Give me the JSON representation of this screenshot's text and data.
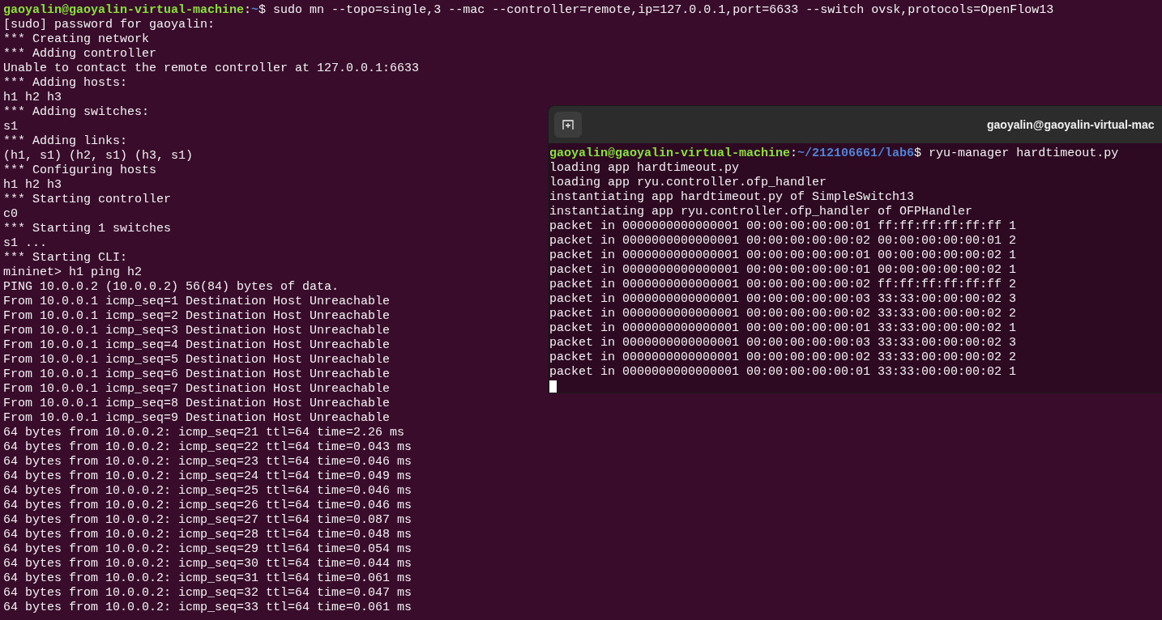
{
  "main_terminal": {
    "lines": [
      {
        "kind": "prompt",
        "user": "gaoyalin@gaoyalin-virtual-machine",
        "separator": ":",
        "path": "~",
        "command": "$ sudo mn --topo=single,3 --mac --controller=remote,ip=127.0.0.1,port=6633 --switch ovsk,protocols=OpenFlow13"
      },
      {
        "kind": "output",
        "text": "[sudo] password for gaoyalin:"
      },
      {
        "kind": "output",
        "text": "*** Creating network"
      },
      {
        "kind": "output",
        "text": "*** Adding controller"
      },
      {
        "kind": "output",
        "text": "Unable to contact the remote controller at 127.0.0.1:6633"
      },
      {
        "kind": "output",
        "text": "*** Adding hosts:"
      },
      {
        "kind": "output",
        "text": "h1 h2 h3"
      },
      {
        "kind": "output",
        "text": "*** Adding switches:"
      },
      {
        "kind": "output",
        "text": "s1"
      },
      {
        "kind": "output",
        "text": "*** Adding links:"
      },
      {
        "kind": "output",
        "text": "(h1, s1) (h2, s1) (h3, s1)"
      },
      {
        "kind": "output",
        "text": "*** Configuring hosts"
      },
      {
        "kind": "output",
        "text": "h1 h2 h3"
      },
      {
        "kind": "output",
        "text": "*** Starting controller"
      },
      {
        "kind": "output",
        "text": "c0"
      },
      {
        "kind": "output",
        "text": "*** Starting 1 switches"
      },
      {
        "kind": "output",
        "text": "s1 ..."
      },
      {
        "kind": "output",
        "text": "*** Starting CLI:"
      },
      {
        "kind": "output",
        "text": "mininet> h1 ping h2"
      },
      {
        "kind": "output",
        "text": "PING 10.0.0.2 (10.0.0.2) 56(84) bytes of data."
      },
      {
        "kind": "output",
        "text": "From 10.0.0.1 icmp_seq=1 Destination Host Unreachable"
      },
      {
        "kind": "output",
        "text": "From 10.0.0.1 icmp_seq=2 Destination Host Unreachable"
      },
      {
        "kind": "output",
        "text": "From 10.0.0.1 icmp_seq=3 Destination Host Unreachable"
      },
      {
        "kind": "output",
        "text": "From 10.0.0.1 icmp_seq=4 Destination Host Unreachable"
      },
      {
        "kind": "output",
        "text": "From 10.0.0.1 icmp_seq=5 Destination Host Unreachable"
      },
      {
        "kind": "output",
        "text": "From 10.0.0.1 icmp_seq=6 Destination Host Unreachable"
      },
      {
        "kind": "output",
        "text": "From 10.0.0.1 icmp_seq=7 Destination Host Unreachable"
      },
      {
        "kind": "output",
        "text": "From 10.0.0.1 icmp_seq=8 Destination Host Unreachable"
      },
      {
        "kind": "output",
        "text": "From 10.0.0.1 icmp_seq=9 Destination Host Unreachable"
      },
      {
        "kind": "output",
        "text": "64 bytes from 10.0.0.2: icmp_seq=21 ttl=64 time=2.26 ms"
      },
      {
        "kind": "output",
        "text": "64 bytes from 10.0.0.2: icmp_seq=22 ttl=64 time=0.043 ms"
      },
      {
        "kind": "output",
        "text": "64 bytes from 10.0.0.2: icmp_seq=23 ttl=64 time=0.046 ms"
      },
      {
        "kind": "output",
        "text": "64 bytes from 10.0.0.2: icmp_seq=24 ttl=64 time=0.049 ms"
      },
      {
        "kind": "output",
        "text": "64 bytes from 10.0.0.2: icmp_seq=25 ttl=64 time=0.046 ms"
      },
      {
        "kind": "output",
        "text": "64 bytes from 10.0.0.2: icmp_seq=26 ttl=64 time=0.046 ms"
      },
      {
        "kind": "output",
        "text": "64 bytes from 10.0.0.2: icmp_seq=27 ttl=64 time=0.087 ms"
      },
      {
        "kind": "output",
        "text": "64 bytes from 10.0.0.2: icmp_seq=28 ttl=64 time=0.048 ms"
      },
      {
        "kind": "output",
        "text": "64 bytes from 10.0.0.2: icmp_seq=29 ttl=64 time=0.054 ms"
      },
      {
        "kind": "output",
        "text": "64 bytes from 10.0.0.2: icmp_seq=30 ttl=64 time=0.044 ms"
      },
      {
        "kind": "output",
        "text": "64 bytes from 10.0.0.2: icmp_seq=31 ttl=64 time=0.061 ms"
      },
      {
        "kind": "output",
        "text": "64 bytes from 10.0.0.2: icmp_seq=32 ttl=64 time=0.047 ms"
      },
      {
        "kind": "output",
        "text": "64 bytes from 10.0.0.2: icmp_seq=33 ttl=64 time=0.061 ms"
      }
    ]
  },
  "ryu_window": {
    "title": "gaoyalin@gaoyalin-virtual-mac",
    "lines": [
      {
        "kind": "prompt",
        "user": "gaoyalin@gaoyalin-virtual-machine",
        "separator": ":",
        "path": "~/212106661/lab6",
        "command": "$ ryu-manager hardtimeout.py"
      },
      {
        "kind": "output",
        "text": "loading app hardtimeout.py"
      },
      {
        "kind": "output",
        "text": "loading app ryu.controller.ofp_handler"
      },
      {
        "kind": "output",
        "text": "instantiating app hardtimeout.py of SimpleSwitch13"
      },
      {
        "kind": "output",
        "text": "instantiating app ryu.controller.ofp_handler of OFPHandler"
      },
      {
        "kind": "output",
        "text": "packet in 0000000000000001 00:00:00:00:00:01 ff:ff:ff:ff:ff:ff 1"
      },
      {
        "kind": "output",
        "text": "packet in 0000000000000001 00:00:00:00:00:02 00:00:00:00:00:01 2"
      },
      {
        "kind": "output",
        "text": "packet in 0000000000000001 00:00:00:00:00:01 00:00:00:00:00:02 1"
      },
      {
        "kind": "output",
        "text": "packet in 0000000000000001 00:00:00:00:00:01 00:00:00:00:00:02 1"
      },
      {
        "kind": "output",
        "text": "packet in 0000000000000001 00:00:00:00:00:02 ff:ff:ff:ff:ff:ff 2"
      },
      {
        "kind": "output",
        "text": "packet in 0000000000000001 00:00:00:00:00:03 33:33:00:00:00:02 3"
      },
      {
        "kind": "output",
        "text": "packet in 0000000000000001 00:00:00:00:00:02 33:33:00:00:00:02 2"
      },
      {
        "kind": "output",
        "text": "packet in 0000000000000001 00:00:00:00:00:01 33:33:00:00:00:02 1"
      },
      {
        "kind": "output",
        "text": "packet in 0000000000000001 00:00:00:00:00:03 33:33:00:00:00:02 3"
      },
      {
        "kind": "output",
        "text": "packet in 0000000000000001 00:00:00:00:00:02 33:33:00:00:00:02 2"
      },
      {
        "kind": "output",
        "text": "packet in 0000000000000001 00:00:00:00:00:01 33:33:00:00:00:02 1"
      },
      {
        "kind": "cursor"
      }
    ]
  }
}
